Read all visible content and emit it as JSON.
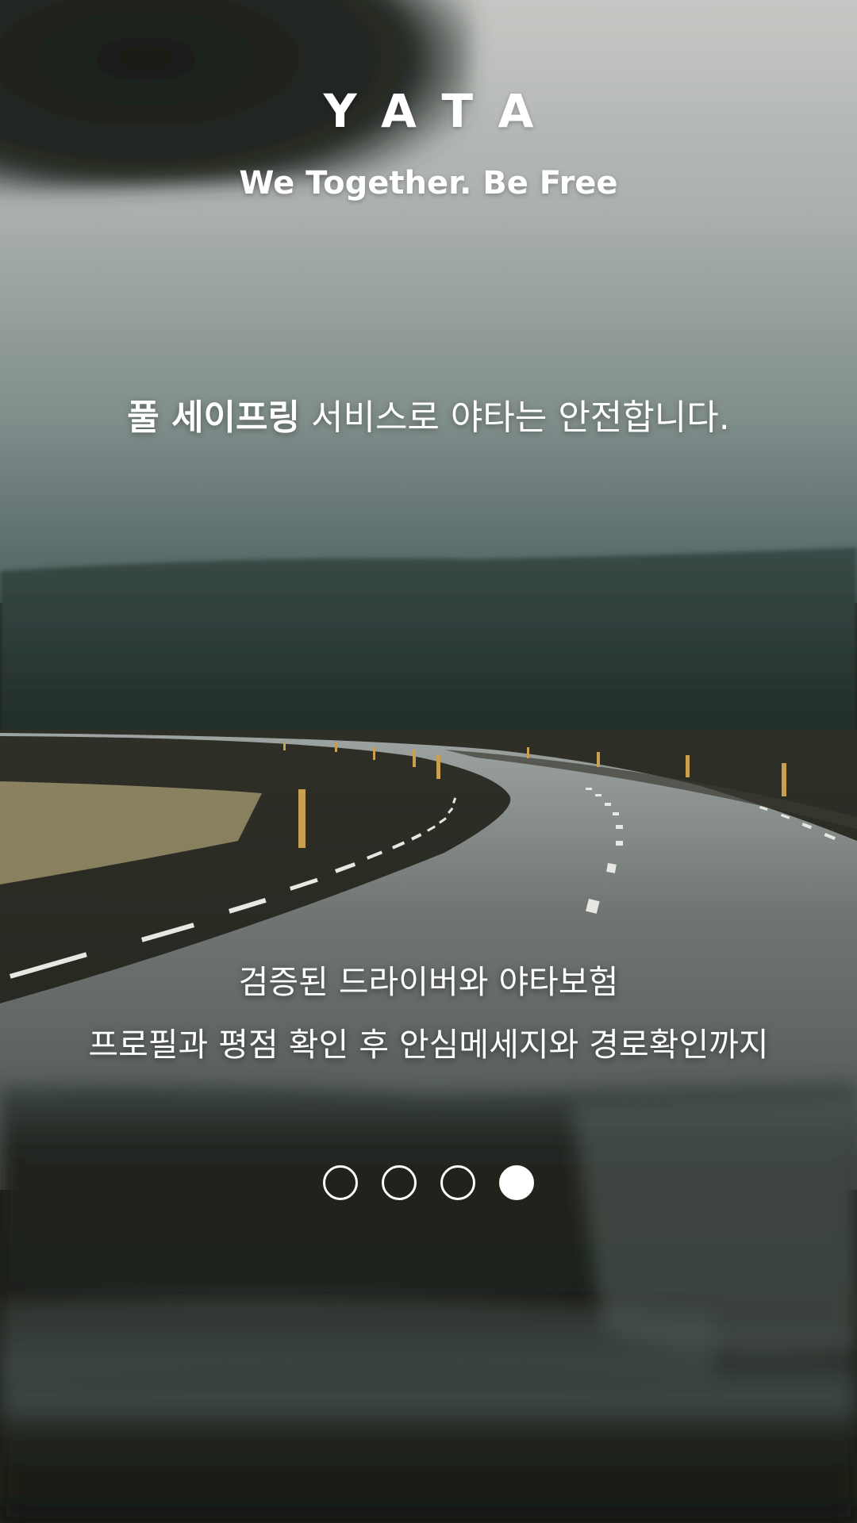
{
  "app": {
    "logo": "YATA",
    "tagline": "We Together. Be Free"
  },
  "headline": {
    "strong": "풀 세이프링",
    "rest": " 서비스로 야타는 안전합니다."
  },
  "description": {
    "line1": "검증된 드라이버와 야타보험",
    "line2": "프로필과 평점 확인 후 안심메세지와 경로확인까지"
  },
  "pagination": {
    "total": 4,
    "active_index": 3
  },
  "colors": {
    "text": "#ffffff",
    "sky": "#a9b0ad",
    "mountain": "#27332f",
    "road": "#5e6462",
    "grass": "#9a8f6a",
    "dashboard": "#1c1d17"
  }
}
